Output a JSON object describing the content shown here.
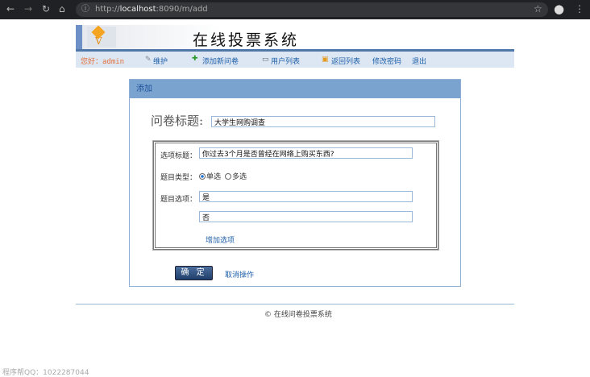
{
  "browser": {
    "url_scheme": "http://",
    "url_host": "localhost",
    "url_rest": ":8090/m/add"
  },
  "header": {
    "site_title": "在线投票系统",
    "logo_text": "V"
  },
  "nav": {
    "greeting": "您好：admin",
    "items": [
      "维护",
      "添加新问卷",
      "用户列表",
      "返回列表",
      "修改密码",
      "退出"
    ]
  },
  "panel": {
    "title": "添加",
    "survey_title_label": "问卷标题:",
    "survey_title_value": "大学生网购调查",
    "question_label": "选项标题：",
    "question_value": "你过去3个月是否曾经在网络上购买东西?",
    "type_label": "题目类型：",
    "type_options": [
      "单选",
      "多选"
    ],
    "type_selected": "单选",
    "options_label": "题目选项：",
    "options": [
      "是",
      "否"
    ],
    "add_option": "增加选项",
    "confirm": "确 定",
    "cancel": "取消操作"
  },
  "footer": {
    "copyright": "© 在线问卷投票系统"
  },
  "watermark": "程序帮QQ：1022287044"
}
